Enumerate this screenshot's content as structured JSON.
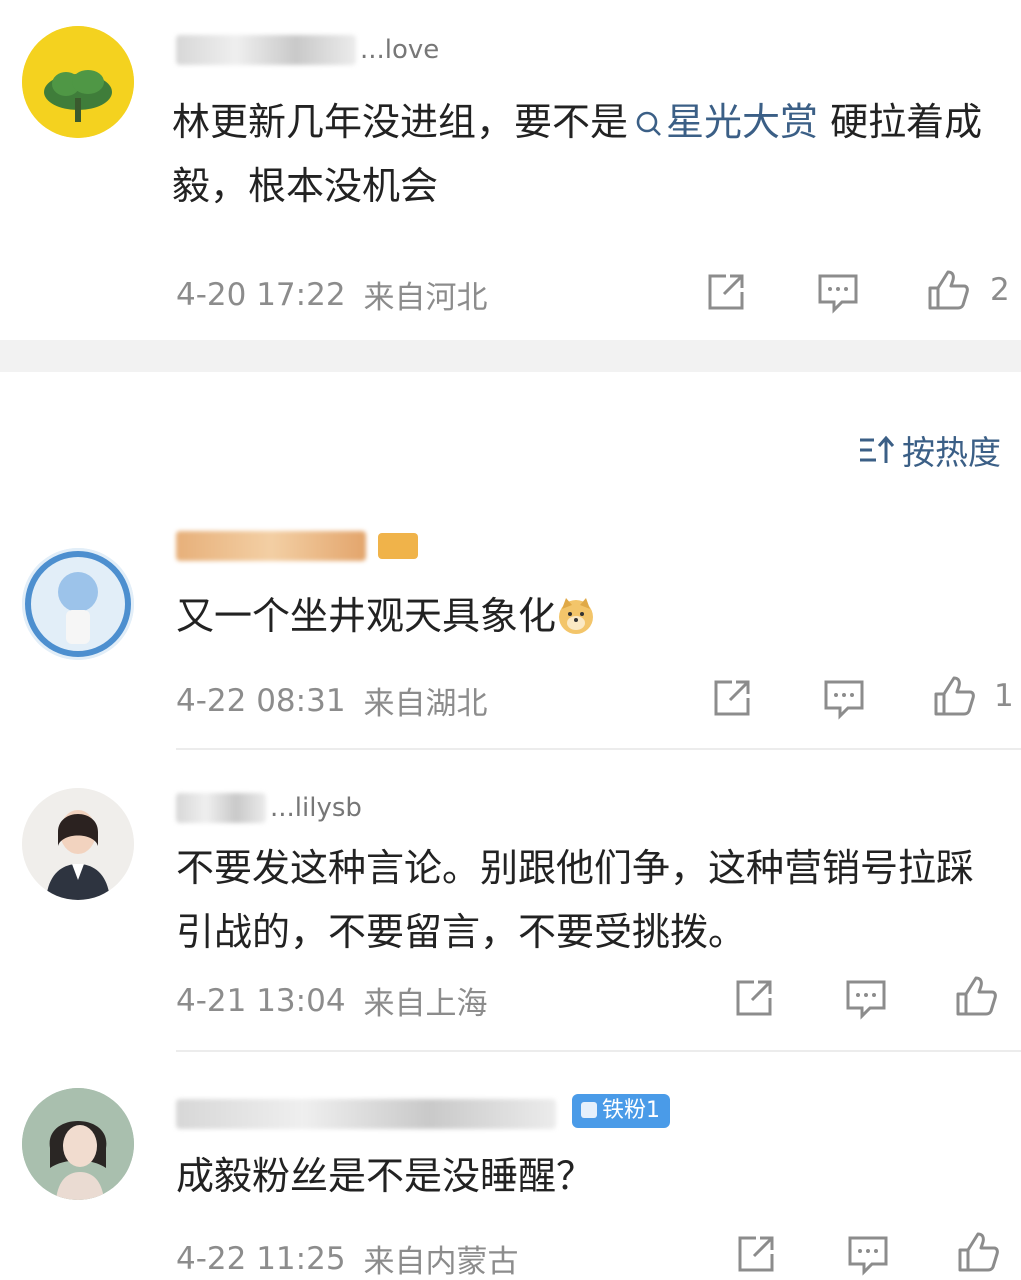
{
  "post": {
    "username": "...love",
    "content_pre": "林更新几年没进组，要不是",
    "topic_icon": "search-icon",
    "topic": "星光大赏",
    "content_post": "硬拉着成毅，根本没机会",
    "time": "4-20 17:22",
    "location": "来自河北",
    "like_count": "2"
  },
  "sort": {
    "label": "按热度",
    "icon": "sort-icon"
  },
  "comments": [
    {
      "username": "...",
      "content": "又一个坐井观天具象化",
      "emoji": "doge-emoji",
      "time": "4-22 08:31",
      "location": "来自湖北",
      "like_count": "1"
    },
    {
      "username": "...lilysb",
      "content": "不要发这种言论。别跟他们争，这种营销号拉踩引战的，不要留言，不要受挑拨。",
      "time": "4-21 13:04",
      "location": "来自上海",
      "like_count": ""
    },
    {
      "username": "...",
      "badge": "铁粉1",
      "content": "成毅粉丝是不是没睡醒？",
      "time": "4-22 11:25",
      "location": "来自内蒙古",
      "like_count": ""
    }
  ],
  "colors": {
    "accent": "#3b5f86",
    "meta": "#8c8c8c",
    "badge": "#4a9be8",
    "divider": "#f2f2f2"
  }
}
